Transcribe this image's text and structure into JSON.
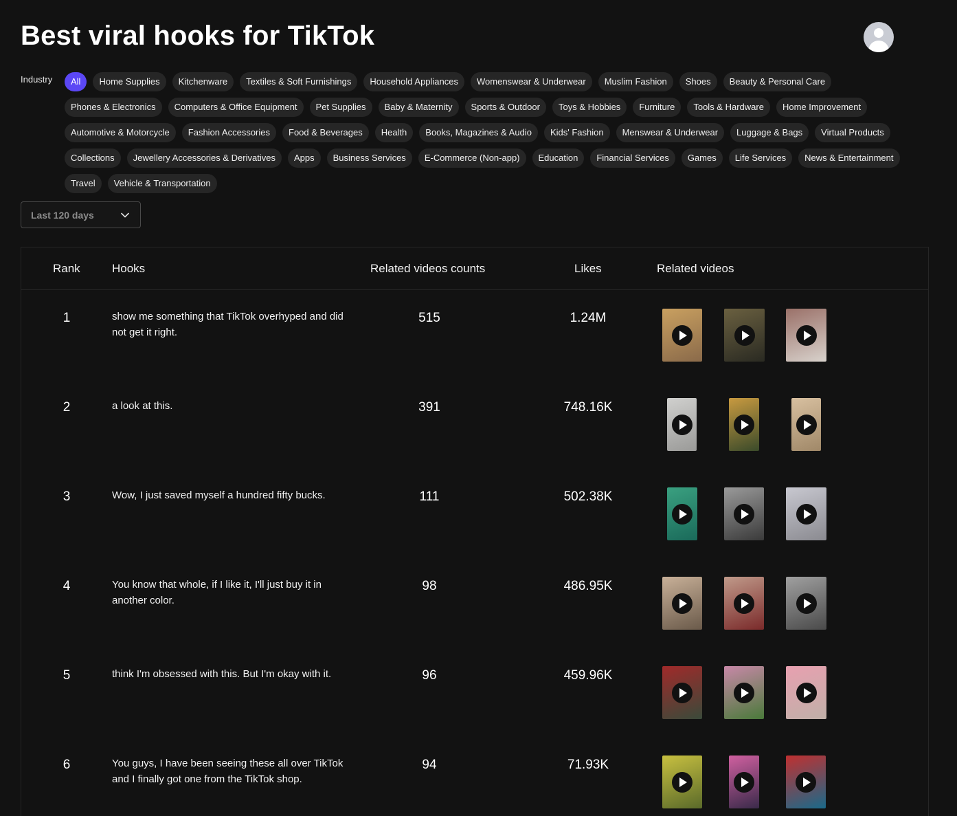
{
  "header": {
    "title": "Best viral hooks for TikTok"
  },
  "filters": {
    "industry_label": "Industry",
    "industries": [
      "All",
      "Home Supplies",
      "Kitchenware",
      "Textiles & Soft Furnishings",
      "Household Appliances",
      "Womenswear & Underwear",
      "Muslim Fashion",
      "Shoes",
      "Beauty & Personal Care",
      "Phones & Electronics",
      "Computers & Office Equipment",
      "Pet Supplies",
      "Baby & Maternity",
      "Sports & Outdoor",
      "Toys & Hobbies",
      "Furniture",
      "Tools & Hardware",
      "Home Improvement",
      "Automotive & Motorcycle",
      "Fashion Accessories",
      "Food & Beverages",
      "Health",
      "Books, Magazines & Audio",
      "Kids' Fashion",
      "Menswear & Underwear",
      "Luggage & Bags",
      "Virtual Products",
      "Collections",
      "Jewellery Accessories & Derivatives",
      "Apps",
      "Business Services",
      "E-Commerce (Non-app)",
      "Education",
      "Financial Services",
      "Games",
      "Life Services",
      "News & Entertainment",
      "Travel",
      "Vehicle & Transportation"
    ],
    "selected_industry": "All",
    "period": "Last 120 days"
  },
  "table": {
    "columns": {
      "rank": "Rank",
      "hooks": "Hooks",
      "counts": "Related videos counts",
      "likes": "Likes",
      "videos": "Related videos"
    },
    "rows": [
      {
        "rank": "1",
        "hook": "show me something that TikTok overhyped and did not get it right.",
        "count": "515",
        "likes": "1.24M",
        "thumbs": [
          [
            "#8a6a4a",
            "#c9a060"
          ],
          [
            "#2a2a22",
            "#6a6040"
          ],
          [
            "#d8d2cc",
            "#9a7068"
          ]
        ]
      },
      {
        "rank": "2",
        "hook": "a look at this.",
        "count": "391",
        "likes": "748.16K",
        "thumbs": [
          [
            "#9a9a98",
            "#d0d0ce"
          ],
          [
            "#3a4a2a",
            "#c89a40"
          ],
          [
            "#a08868",
            "#d8c0a0"
          ]
        ]
      },
      {
        "rank": "3",
        "hook": "Wow, I just saved myself a hundred fifty bucks.",
        "count": "111",
        "likes": "502.38K",
        "thumbs": [
          [
            "#1a6a5a",
            "#3aa080"
          ],
          [
            "#3a3a3a",
            "#9a9a9a"
          ],
          [
            "#8a8a90",
            "#c8c8d0"
          ]
        ]
      },
      {
        "rank": "4",
        "hook": "You know that whole, if I like it, I'll just buy it in another color.",
        "count": "98",
        "likes": "486.95K",
        "thumbs": [
          [
            "#6a5a4a",
            "#c8b098"
          ],
          [
            "#7a2a2a",
            "#c09a8a"
          ],
          [
            "#4a4a4a",
            "#a0a0a0"
          ]
        ]
      },
      {
        "rank": "5",
        "hook": "think I'm obsessed with this. But I'm okay with it.",
        "count": "96",
        "likes": "459.96K",
        "thumbs": [
          [
            "#3a4a3a",
            "#a02a2a"
          ],
          [
            "#4a7a3a",
            "#c888a8"
          ],
          [
            "#c0b0a8",
            "#e8a0b0"
          ]
        ]
      },
      {
        "rank": "6",
        "hook": "You guys, I have been seeing these all over TikTok and I finally got one from the TikTok shop.",
        "count": "94",
        "likes": "71.93K",
        "thumbs": [
          [
            "#5a6a2a",
            "#c8c040"
          ],
          [
            "#3a2a4a",
            "#d060a0"
          ],
          [
            "#1a6a8a",
            "#c03030"
          ]
        ]
      }
    ]
  }
}
